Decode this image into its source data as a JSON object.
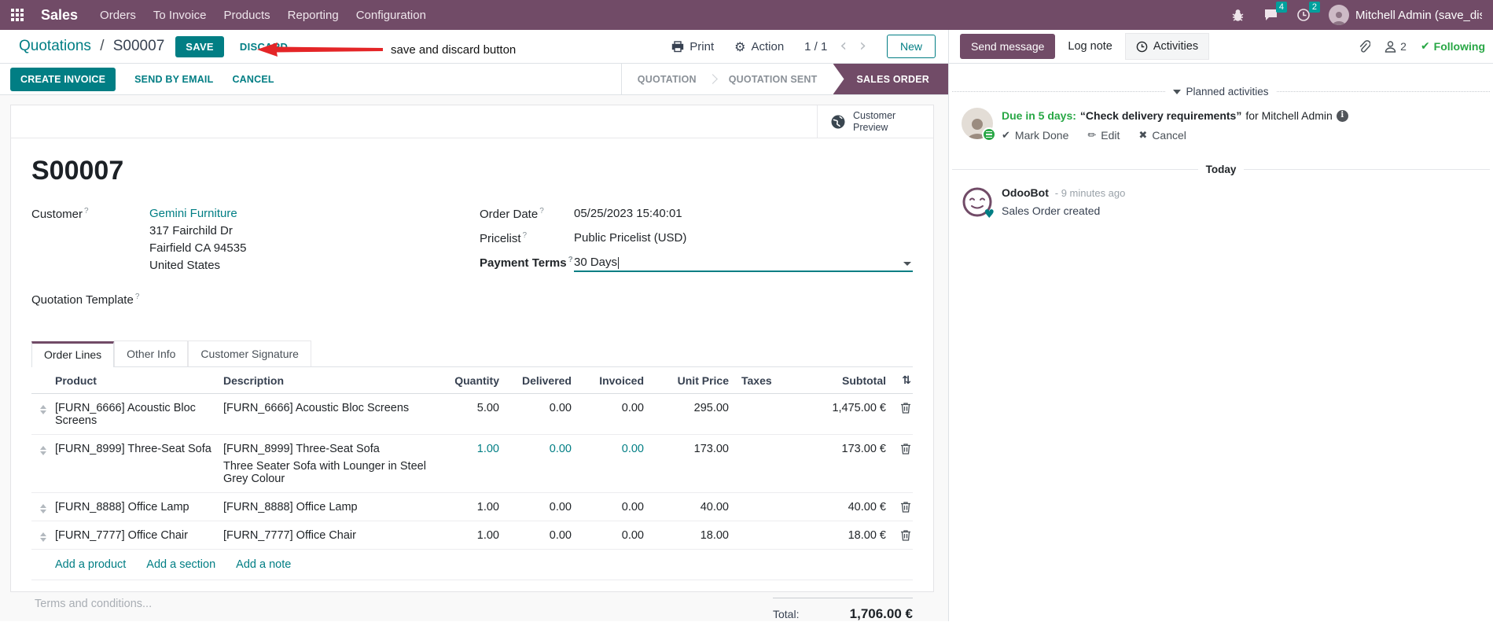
{
  "colors": {
    "brand": "#714B67",
    "primary": "#017E84",
    "success": "#28a745",
    "systray_badge": "#00A09D",
    "annotation_red": "#e42527"
  },
  "app": {
    "name": "Sales",
    "menus": [
      {
        "label": "Orders"
      },
      {
        "label": "To Invoice"
      },
      {
        "label": "Products"
      },
      {
        "label": "Reporting"
      },
      {
        "label": "Configuration"
      }
    ],
    "systray": {
      "message_count": "4",
      "activity_count": "2",
      "user": "Mitchell Admin (save_discar"
    }
  },
  "breadcrumb": {
    "parent": "Quotations",
    "sep": "/",
    "current": "S00007",
    "save": "SAVE",
    "discard": "DISCARD"
  },
  "annotation": {
    "text": "save and discard button"
  },
  "control_panel": {
    "print": "Print",
    "action": "Action",
    "pager": "1 / 1",
    "prev": "‹",
    "next": "›",
    "new": "New"
  },
  "action_buttons": {
    "create_invoice": "CREATE INVOICE",
    "send_by_email": "SEND BY EMAIL",
    "cancel": "CANCEL"
  },
  "statusbar": {
    "steps": [
      {
        "label": "QUOTATION"
      },
      {
        "label": "QUOTATION SENT"
      },
      {
        "label": "SALES ORDER"
      }
    ]
  },
  "form": {
    "name": "S00007",
    "preview_label": "Customer Preview",
    "customer_label": "Customer",
    "help": "?",
    "customer_name": "Gemini Furniture",
    "address": [
      "317 Fairchild Dr",
      "Fairfield CA 94535",
      "United States"
    ],
    "quotation_template_label": "Quotation Template",
    "order_date_label": "Order Date",
    "order_date": "05/25/2023 15:40:01",
    "pricelist_label": "Pricelist",
    "pricelist": "Public Pricelist (USD)",
    "payment_terms_label": "Payment Terms",
    "payment_terms": "30 Days"
  },
  "tabs": [
    {
      "label": "Order Lines"
    },
    {
      "label": "Other Info"
    },
    {
      "label": "Customer Signature"
    }
  ],
  "order_lines": {
    "columns": [
      "Product",
      "Description",
      "Quantity",
      "Delivered",
      "Invoiced",
      "Unit Price",
      "Taxes",
      "Subtotal"
    ],
    "rows": [
      {
        "product": "[FURN_6666] Acoustic Bloc Screens",
        "description": "[FURN_6666] Acoustic Bloc Screens",
        "description2": "",
        "quantity": "5.00",
        "delivered": "0.00",
        "invoiced": "0.00",
        "unit_price": "295.00",
        "taxes": "",
        "subtotal": "1,475.00 €"
      },
      {
        "product": "[FURN_8999] Three-Seat Sofa",
        "description": "[FURN_8999] Three-Seat Sofa",
        "description2": "Three Seater Sofa with Lounger in Steel Grey Colour",
        "quantity": "1.00",
        "delivered": "0.00",
        "invoiced": "0.00",
        "unit_price": "173.00",
        "taxes": "",
        "subtotal": "173.00 €"
      },
      {
        "product": "[FURN_8888] Office Lamp",
        "description": "[FURN_8888] Office Lamp",
        "description2": "",
        "quantity": "1.00",
        "delivered": "0.00",
        "invoiced": "0.00",
        "unit_price": "40.00",
        "taxes": "",
        "subtotal": "40.00 €"
      },
      {
        "product": "[FURN_7777] Office Chair",
        "description": "[FURN_7777] Office Chair",
        "description2": "",
        "quantity": "1.00",
        "delivered": "0.00",
        "invoiced": "0.00",
        "unit_price": "18.00",
        "taxes": "",
        "subtotal": "18.00 €"
      }
    ],
    "links": [
      {
        "label": "Add a product"
      },
      {
        "label": "Add a section"
      },
      {
        "label": "Add a note"
      }
    ],
    "terms_placeholder": "Terms and conditions...",
    "total_label": "Total:",
    "total": "1,706.00 €"
  },
  "chatter": {
    "send_message": "Send message",
    "log_note": "Log note",
    "activities": "Activities",
    "follower_count": "2",
    "following": "Following",
    "planned_header": "Planned activities",
    "activity": {
      "due": "Due in 5 days:",
      "summary": "“Check delivery requirements”",
      "for_user": "for Mitchell Admin",
      "mark_done": "Mark Done",
      "edit": "Edit",
      "cancel": "Cancel"
    },
    "today": "Today",
    "message": {
      "author": "OdooBot",
      "time": "- 9 minutes ago",
      "body": "Sales Order created"
    }
  }
}
